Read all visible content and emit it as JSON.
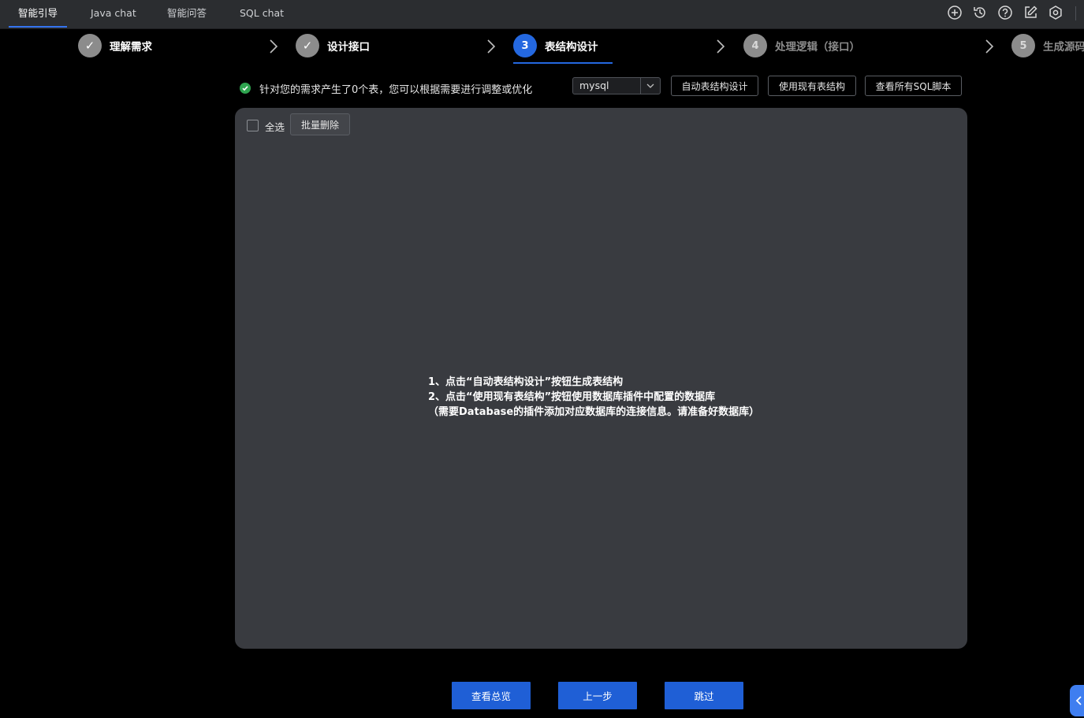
{
  "tabs": [
    {
      "label": "智能引导",
      "active": true
    },
    {
      "label": "Java chat",
      "active": false
    },
    {
      "label": "智能问答",
      "active": false
    },
    {
      "label": "SQL chat",
      "active": false
    }
  ],
  "toolbar_icons": [
    "add-circle-icon",
    "history-icon",
    "help-icon",
    "edit-icon",
    "settings-icon"
  ],
  "steps": [
    {
      "number": "✓",
      "label": "理解需求",
      "state": "done"
    },
    {
      "number": "✓",
      "label": "设计接口",
      "state": "done"
    },
    {
      "number": "3",
      "label": "表结构设计",
      "state": "current"
    },
    {
      "number": "4",
      "label": "处理逻辑（接口）",
      "state": "todo"
    },
    {
      "number": "5",
      "label": "生成源码",
      "state": "todo"
    }
  ],
  "status": {
    "text": "针对您的需求产生了0个表，您可以根据需要进行调整或优化"
  },
  "db_select": {
    "value": "mysql"
  },
  "actions": {
    "auto_design": "自动表结构设计",
    "use_existing": "使用现有表结构",
    "view_sql": "查看所有SQL脚本"
  },
  "panel": {
    "select_all": "全选",
    "batch_delete": "批量删除",
    "hint_lines": [
      "1、点击“自动表结构设计”按钮生成表结构",
      "2、点击“使用现有表结构”按钮使用数据库插件中配置的数据库",
      "（需要Database的插件添加对应数据库的连接信息。请准备好数据库）"
    ]
  },
  "footer": {
    "overview": "查看总览",
    "prev": "上一步",
    "skip": "跳过"
  },
  "colors": {
    "accent": "#1f5fd6",
    "step_current": "#2468e0",
    "success": "#2ea44f",
    "panel_bg": "#393b40"
  }
}
